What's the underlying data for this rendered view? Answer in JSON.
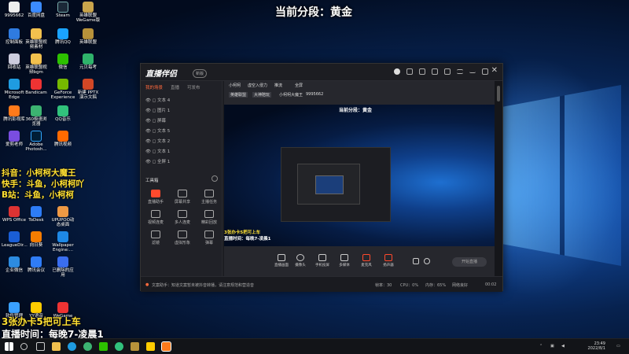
{
  "overlay": {
    "top_title": "当前分段：黄金",
    "line1": "抖音：小柯柯大魔王",
    "line2": "快手：斗鱼，小柯柯吖",
    "line3": "B站：斗鱼，小柯柯",
    "bottom1": "3张办卡5把可上车",
    "bottom2": "直播时间：每晚7-凌晨1"
  },
  "desktop_icons": [
    {
      "label": "9995662"
    },
    {
      "label": "百度网盘"
    },
    {
      "label": "Steam"
    },
    {
      "label": "英雄联盟WeGame版"
    },
    {
      "label": "控制面板"
    },
    {
      "label": "英雄联盟视频素材"
    },
    {
      "label": "腾讯QQ"
    },
    {
      "label": "英雄联盟"
    },
    {
      "label": "回收站"
    },
    {
      "label": "英雄联盟视频bgm"
    },
    {
      "label": "微信"
    },
    {
      "label": "元贝每考"
    },
    {
      "label": "Microsoft Edge"
    },
    {
      "label": "Bandicam"
    },
    {
      "label": "GeForce Experience"
    },
    {
      "label": "新建 PPTX 演示文稿"
    },
    {
      "label": "腾讯影视库"
    },
    {
      "label": "360极速浏览器"
    },
    {
      "label": "QQ音乐"
    },
    {
      "label": "爱剪老师"
    },
    {
      "label": "Adobe Photosh..."
    },
    {
      "label": "腾讯视频"
    },
    {
      "label": "WPS Office"
    },
    {
      "label": "ToDesk"
    },
    {
      "label": "UPUPOO动态桌面"
    },
    {
      "label": "LeagueDir..."
    },
    {
      "label": "向日葵"
    },
    {
      "label": "Wallpaper Engine:..."
    },
    {
      "label": "企业微信"
    },
    {
      "label": "腾讯会议"
    },
    {
      "label": "已删除的应用"
    },
    {
      "label": "软件管理"
    },
    {
      "label": "YY语音"
    },
    {
      "label": "WeGame"
    }
  ],
  "app": {
    "logo": "直播伴侣",
    "version": "新版",
    "left_tabs": [
      "我的场景",
      "直播",
      "可发布"
    ],
    "sources": [
      "文本 4",
      "图片 1",
      "屏幕",
      "文本 5",
      "文本 2",
      "文本 1",
      "全屏 1"
    ],
    "tool_section": "工具箱",
    "tools": [
      "直播助手",
      "屏幕共享",
      "主播任务",
      "视频连麦",
      "多人连麦",
      "精彩回放",
      "滤镜",
      "虚拟形象",
      "弹幕"
    ],
    "stage_header": {
      "a": "小柯柯",
      "b": "虚空入侵力",
      "c": "推流",
      "d": "全屏",
      "tag1": "英雄联盟",
      "tag2": "大神陪玩",
      "tag3": "小柯柯大魔王",
      "id": "9995662"
    },
    "preview_title": "当前分段：黄金",
    "preview_bottom1": "3张办卡5把可上车",
    "preview_bottom2": "直播时间：每晚7-凌晨1",
    "controls": [
      "直播画面",
      "摄像头",
      "手机投屏",
      "多媒体",
      "麦克风",
      "扬声器"
    ],
    "go_live": "开始直播",
    "footer": {
      "notice": "文案助手：知道文案暂未被抖音转播，请注意规范和营造音",
      "fps": "帧率：30",
      "cpu": "CPU：0%",
      "mem": "内存：65%",
      "net": "网络良好",
      "time": "00:02"
    }
  },
  "taskbar": {
    "time": "23:49",
    "date": "2022/8/1"
  },
  "colors": {
    "accent": "#ff4a2d",
    "overlay_yellow": "#ffe033"
  }
}
